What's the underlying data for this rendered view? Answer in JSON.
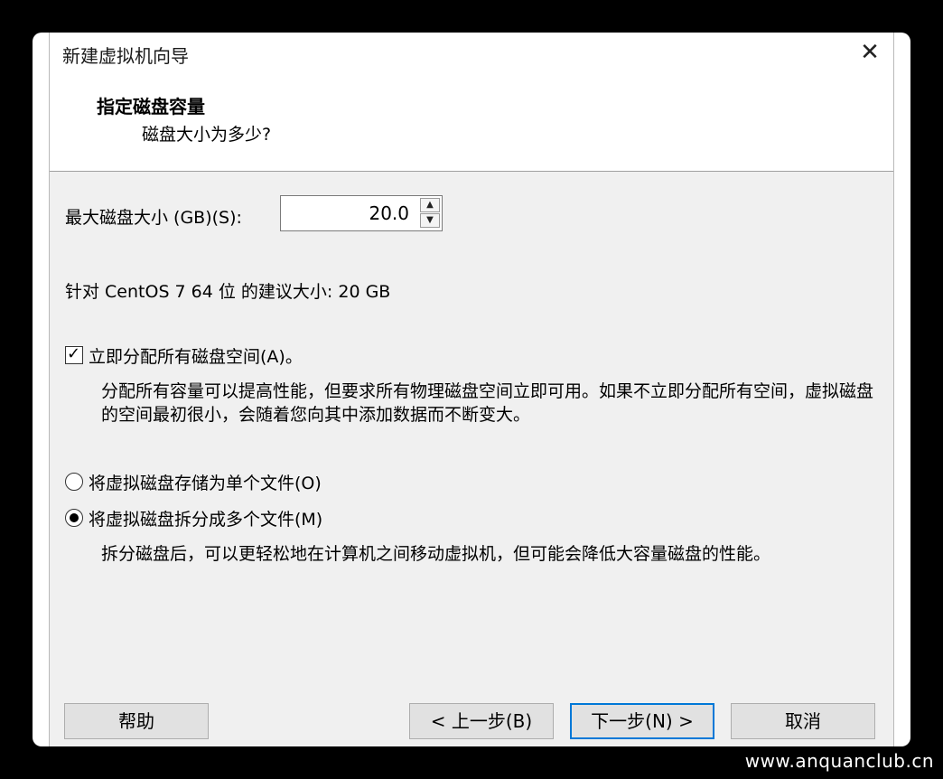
{
  "window": {
    "title": "新建虚拟机向导",
    "close_glyph": "✕"
  },
  "header": {
    "title": "指定磁盘容量",
    "subtitle": "磁盘大小为多少?"
  },
  "disk": {
    "size_label": "最大磁盘大小 (GB)(S):",
    "size_value": "20.0",
    "recommend_text": "针对 CentOS 7 64 位 的建议大小: 20 GB"
  },
  "allocate": {
    "label": "立即分配所有磁盘空间(A)。",
    "checked": true,
    "description": "分配所有容量可以提高性能，但要求所有物理磁盘空间立即可用。如果不立即分配所有空间，虚拟磁盘的空间最初很小，会随着您向其中添加数据而不断变大。"
  },
  "storage": {
    "single_label": "将虚拟磁盘存储为单个文件(O)",
    "multi_label": "将虚拟磁盘拆分成多个文件(M)",
    "selected": "multi",
    "multi_description": "拆分磁盘后，可以更轻松地在计算机之间移动虚拟机，但可能会降低大容量磁盘的性能。"
  },
  "buttons": {
    "help": "帮助",
    "back": "< 上一步(B)",
    "next": "下一步(N) >",
    "cancel": "取消"
  },
  "watermark": "www.anquanclub.cn",
  "colors": {
    "focus_border": "#0078d7",
    "panel_bg": "#f0f0f0"
  }
}
